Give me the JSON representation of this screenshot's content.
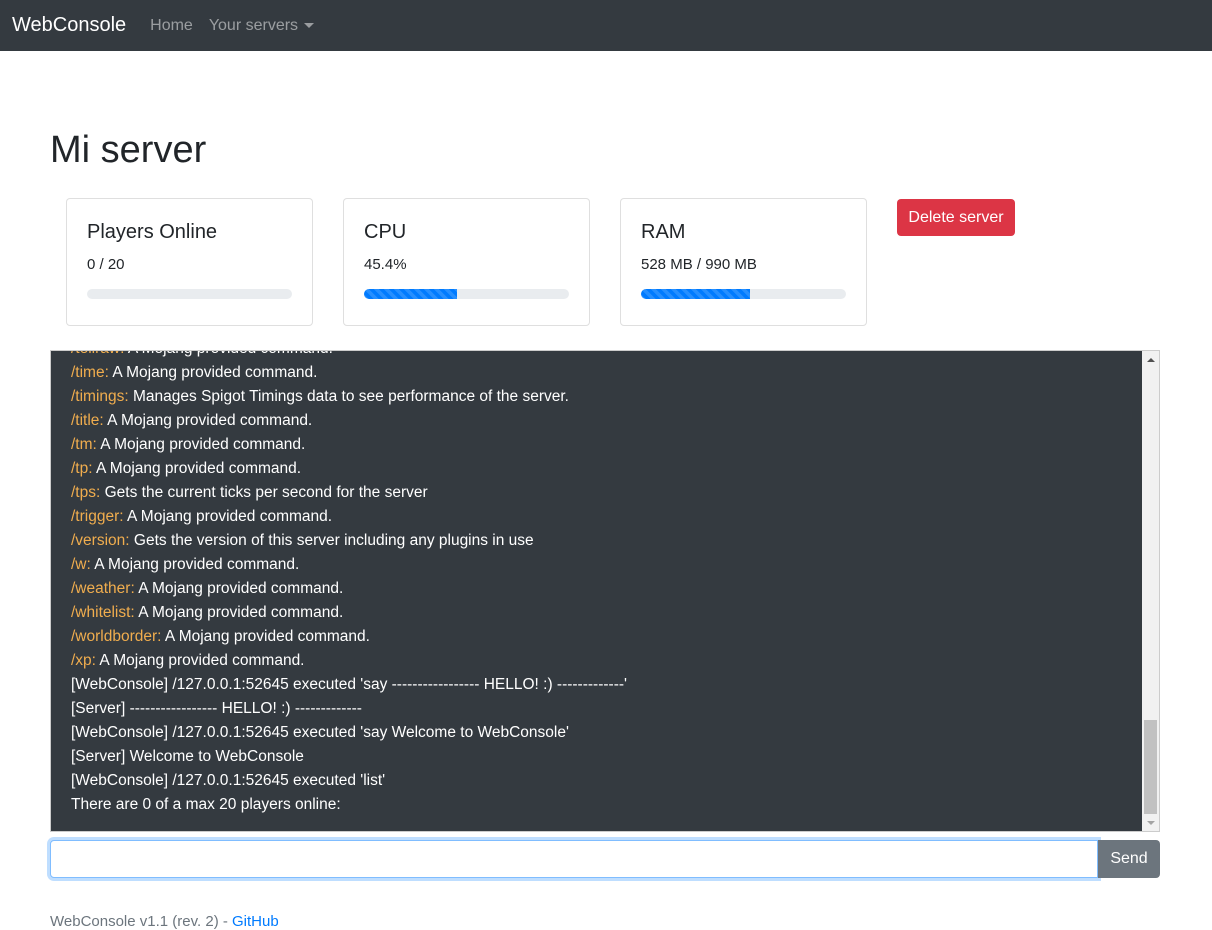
{
  "navbar": {
    "brand": "WebConsole",
    "links": [
      {
        "label": "Home"
      },
      {
        "label": "Your servers",
        "dropdown": true
      }
    ]
  },
  "page": {
    "title": "Mi server"
  },
  "stats": {
    "players": {
      "title": "Players Online",
      "value": "0 / 20",
      "progress_percent": 0
    },
    "cpu": {
      "title": "CPU",
      "value": "45.4%",
      "progress_percent": 45.4
    },
    "ram": {
      "title": "RAM",
      "value": "528 MB / 990 MB",
      "progress_percent": 53.3
    }
  },
  "actions": {
    "delete_label": "Delete server"
  },
  "console": {
    "lines": [
      {
        "cmd": "/tellraw:",
        "text": " A Mojang provided command."
      },
      {
        "cmd": "/time:",
        "text": " A Mojang provided command."
      },
      {
        "cmd": "/timings:",
        "text": " Manages Spigot Timings data to see performance of the server."
      },
      {
        "cmd": "/title:",
        "text": " A Mojang provided command."
      },
      {
        "cmd": "/tm:",
        "text": " A Mojang provided command."
      },
      {
        "cmd": "/tp:",
        "text": " A Mojang provided command."
      },
      {
        "cmd": "/tps:",
        "text": " Gets the current ticks per second for the server"
      },
      {
        "cmd": "/trigger:",
        "text": " A Mojang provided command."
      },
      {
        "cmd": "/version:",
        "text": " Gets the version of this server including any plugins in use"
      },
      {
        "cmd": "/w:",
        "text": " A Mojang provided command."
      },
      {
        "cmd": "/weather:",
        "text": " A Mojang provided command."
      },
      {
        "cmd": "/whitelist:",
        "text": " A Mojang provided command."
      },
      {
        "cmd": "/worldborder:",
        "text": " A Mojang provided command."
      },
      {
        "cmd": "/xp:",
        "text": " A Mojang provided command."
      },
      {
        "cmd": "",
        "text": "[WebConsole] /127.0.0.1:52645 executed 'say ----------------- HELLO! :) -------------'"
      },
      {
        "cmd": "",
        "text": "[Server] ----------------- HELLO! :) -------------"
      },
      {
        "cmd": "",
        "text": "[WebConsole] /127.0.0.1:52645 executed 'say Welcome to WebConsole'"
      },
      {
        "cmd": "",
        "text": "[Server] Welcome to WebConsole"
      },
      {
        "cmd": "",
        "text": "[WebConsole] /127.0.0.1:52645 executed 'list'"
      },
      {
        "cmd": "",
        "text": "There are 0 of a max 20 players online:"
      }
    ]
  },
  "input": {
    "value": "",
    "placeholder": "",
    "send_label": "Send"
  },
  "footer": {
    "text": "WebConsole v1.1 (rev. 2) - ",
    "link_label": "GitHub"
  },
  "colors": {
    "command": "#f0ad4e",
    "console_bg": "#343a40",
    "danger": "#dc3545",
    "primary": "#007bff"
  }
}
